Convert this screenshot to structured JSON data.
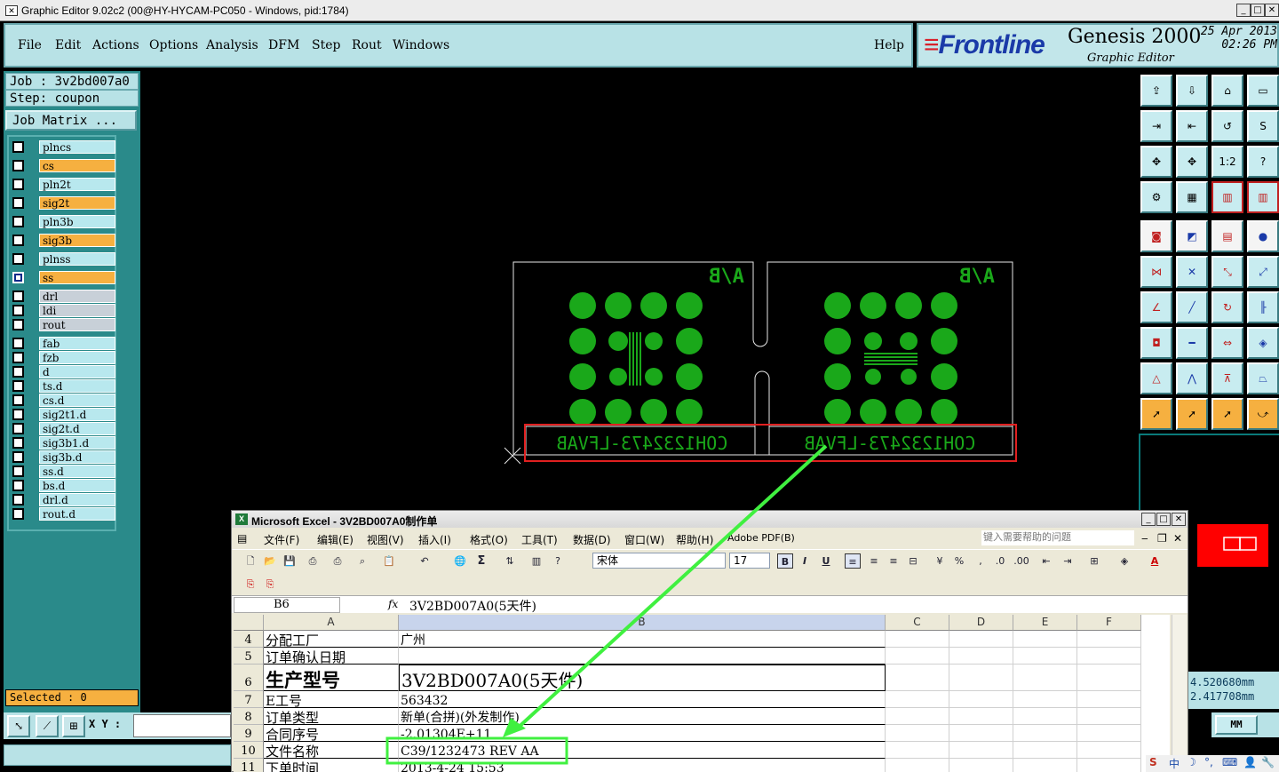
{
  "window": {
    "title": "Graphic Editor 9.02c2 (00@HY-HYCAM-PC050 - Windows, pid:1784)",
    "icon": "app-icon"
  },
  "menu": {
    "items": [
      {
        "label": "File",
        "key": "F"
      },
      {
        "label": "Edit",
        "key": "E"
      },
      {
        "label": "Actions",
        "key": "A"
      },
      {
        "label": "Options",
        "key": "O"
      },
      {
        "label": "Analysis",
        "key": "A"
      },
      {
        "label": "DFM",
        "key": "D"
      },
      {
        "label": "Step",
        "key": "S"
      },
      {
        "label": "Rout",
        "key": "R"
      },
      {
        "label": "Windows",
        "key": "W"
      }
    ],
    "help": "Help"
  },
  "brand": {
    "logo": "Frontline",
    "product": "Genesis 2000",
    "subtitle": "Graphic Editor",
    "date": "25 Apr 2013",
    "time": "02:26 PM"
  },
  "job": {
    "job_line": "Job : 3v2bd007a0",
    "step_line": "Step: coupon",
    "matrix_button": "Job Matrix ..."
  },
  "layers": [
    {
      "name": "plncs",
      "color": "cyan",
      "active": false
    },
    {
      "name": "cs",
      "color": "orange",
      "active": false
    },
    {
      "name": "pln2t",
      "color": "cyan",
      "active": false
    },
    {
      "name": "sig2t",
      "color": "orange",
      "active": false
    },
    {
      "name": "pln3b",
      "color": "cyan",
      "active": false
    },
    {
      "name": "sig3b",
      "color": "orange",
      "active": false
    },
    {
      "name": "plnss",
      "color": "cyan",
      "active": false
    },
    {
      "name": "ss",
      "color": "orange",
      "active": true
    },
    {
      "name": "drl",
      "color": "gray",
      "active": false
    },
    {
      "name": "ldi",
      "color": "gray",
      "active": false
    },
    {
      "name": "rout",
      "color": "gray",
      "active": false
    },
    {
      "name": "fab",
      "color": "cyan",
      "active": false
    },
    {
      "name": "fzb",
      "color": "cyan",
      "active": false
    },
    {
      "name": "d",
      "color": "cyan",
      "active": false
    },
    {
      "name": "ts.d",
      "color": "cyan",
      "active": false
    },
    {
      "name": "cs.d",
      "color": "cyan",
      "active": false
    },
    {
      "name": "sig2t1.d",
      "color": "cyan",
      "active": false
    },
    {
      "name": "sig2t.d",
      "color": "cyan",
      "active": false
    },
    {
      "name": "sig3b1.d",
      "color": "cyan",
      "active": false
    },
    {
      "name": "sig3b.d",
      "color": "cyan",
      "active": false
    },
    {
      "name": "ss.d",
      "color": "cyan",
      "active": false
    },
    {
      "name": "bs.d",
      "color": "cyan",
      "active": false
    },
    {
      "name": "drl.d",
      "color": "cyan",
      "active": false
    },
    {
      "name": "rout.d",
      "color": "cyan",
      "active": false
    }
  ],
  "status": {
    "selected": "Selected : 0",
    "xy_label": "X Y :"
  },
  "canvas": {
    "panel_label": "A/B",
    "panel_text": "COH1232473-LFVAB",
    "pad_color": "#1aa81a",
    "highlight_color": "#e02020",
    "arrow_color": "#40f040"
  },
  "coords": {
    "x": "4.520680mm",
    "y": "2.417708mm",
    "units": "MM"
  },
  "excel": {
    "title": "Microsoft Excel - 3V2BD007A0制作单",
    "menu": [
      "文件(F)",
      "编辑(E)",
      "视图(V)",
      "插入(I)",
      "格式(O)",
      "工具(T)",
      "数据(D)",
      "窗口(W)",
      "帮助(H)",
      "Adobe PDF(B)"
    ],
    "help_placeholder": "键入需要帮助的问题",
    "font_name": "宋体",
    "font_size": "17",
    "name_box": "B6",
    "fx": "fx",
    "formula": "3V2BD007A0(5天件)",
    "columns": [
      "A",
      "B",
      "C",
      "D",
      "E",
      "F"
    ],
    "rows": [
      {
        "num": "4",
        "a": "分配工厂",
        "b": "广州"
      },
      {
        "num": "5",
        "a": "订单确认日期",
        "b": ""
      },
      {
        "num": "6",
        "a": "生产型号",
        "b": "3V2BD007A0(5天件)"
      },
      {
        "num": "7",
        "a": "E工号",
        "b": "563432"
      },
      {
        "num": "8",
        "a": "订单类型",
        "b": "新单(合拼)(外发制作)"
      },
      {
        "num": "9",
        "a": "合同序号",
        "b": "-2.01304E+11"
      },
      {
        "num": "10",
        "a": "文件名称",
        "b": "C39/1232473 REV AA"
      },
      {
        "num": "11",
        "a": "下单时间",
        "b": "2013-4-24 15:53"
      }
    ]
  },
  "tray": {
    "ime": "中"
  }
}
